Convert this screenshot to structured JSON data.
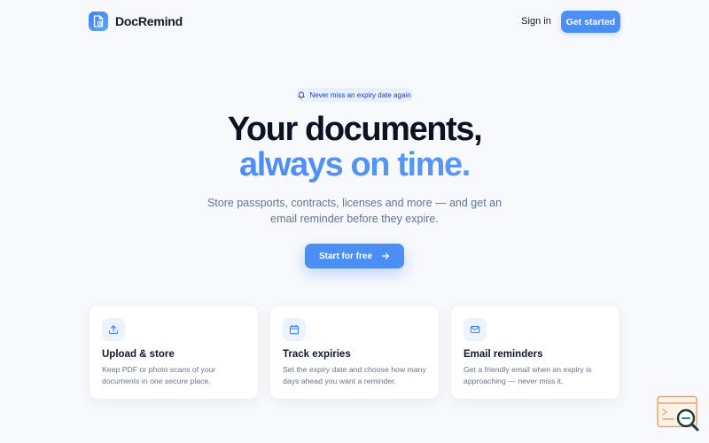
{
  "brand": {
    "name": "DocRemind"
  },
  "nav": {
    "signin": "Sign in",
    "get_started": "Get started"
  },
  "hero": {
    "pill": "Never miss an expiry date again",
    "headline_line1": "Your documents,",
    "headline_line2": "always on time.",
    "subtitle": "Store passports, contracts, licenses and more — and get an email reminder before they expire.",
    "cta": "Start for free"
  },
  "features": [
    {
      "icon": "upload-icon",
      "title": "Upload & store",
      "desc": "Keep PDF or photo scans of your documents in one secure place."
    },
    {
      "icon": "calendar-icon",
      "title": "Track expiries",
      "desc": "Set the expiry date and choose how many days ahead you want a reminder."
    },
    {
      "icon": "mail-icon",
      "title": "Email reminders",
      "desc": "Get a friendly email when an expiry is approaching — never miss it."
    }
  ],
  "colors": {
    "accent": "#4b8ff4",
    "background": "#f7f9fc",
    "text": "#0f172a",
    "muted": "#64748b"
  }
}
